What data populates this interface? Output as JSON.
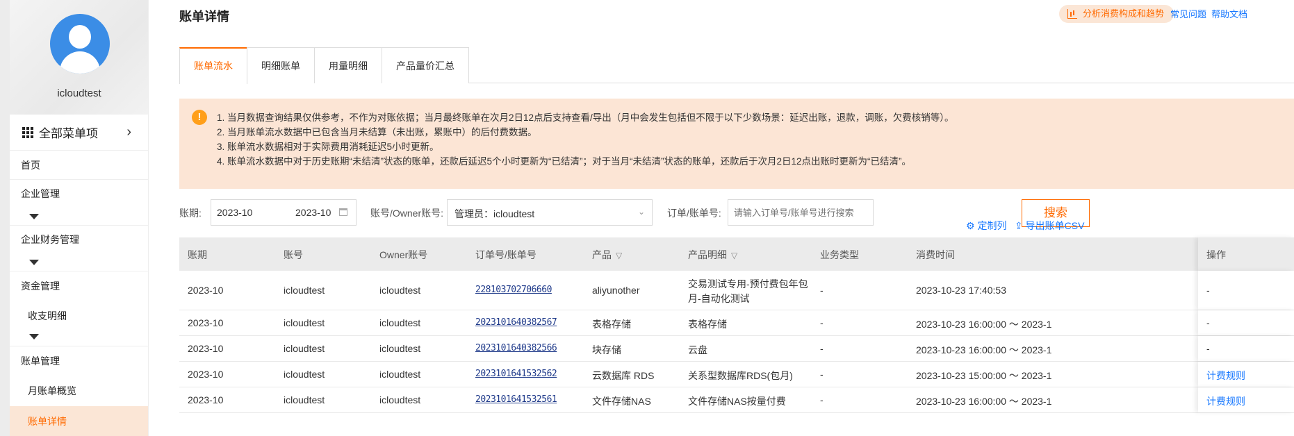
{
  "sidebar": {
    "username": "icloudtest",
    "all_menu": "全部菜单项",
    "items": [
      {
        "label": "首页"
      },
      {
        "label": "企业管理"
      },
      {
        "label": "企业财务管理"
      },
      {
        "label": "资金管理"
      },
      {
        "label": "收支明细"
      },
      {
        "label": "账单管理"
      },
      {
        "label": "月账单概览"
      },
      {
        "label": "账单详情"
      }
    ]
  },
  "header": {
    "title": "账单详情",
    "analyze": "分析消费构成和趋势",
    "faq": "常见问题",
    "help": "帮助文档"
  },
  "tabs": [
    "账单流水",
    "明细账单",
    "用量明细",
    "产品量价汇总"
  ],
  "notice": [
    "1. 当月数据查询结果仅供参考，不作为对账依据；当月最终账单在次月2日12点后支持查看/导出（月中会发生包括但不限于以下少数场景：延迟出账，退款，调账，欠费核销等）。",
    "2. 当月账单流水数据中已包含当月未结算（未出账，累账中）的后付费数据。",
    "3. 账单流水数据相对于实际费用消耗延迟5小时更新。",
    "4. 账单流水数据中对于历史账期“未结清”状态的账单，还款后延迟5个小时更新为“已结清”；对于当月“未结清”状态的账单，还款后于次月2日12点出账时更新为“已结清”。"
  ],
  "filters": {
    "period_label": "账期:",
    "period_start": "2023-10",
    "period_end": "2023-10",
    "account_label": "账号/Owner账号:",
    "account_value": "管理员：icloudtest",
    "order_label": "订单/账单号:",
    "order_placeholder": "请输入订单号/账单号进行搜索",
    "search": "搜索",
    "customize": "定制列",
    "export": "导出账单CSV"
  },
  "table": {
    "headers": [
      "账期",
      "账号",
      "Owner账号",
      "订单号/账单号",
      "产品",
      "产品明细",
      "业务类型",
      "消费时间",
      "操作"
    ],
    "rows": [
      {
        "period": "2023-10",
        "account": "icloudtest",
        "owner": "icloudtest",
        "order": "228103702706660",
        "product": "aliyunother",
        "detail": "交易测试专用-预付费包年包",
        "detail2": "月-自动化测试",
        "biz": "-",
        "time": "2023-10-23 17:40:53",
        "op": "-"
      },
      {
        "period": "2023-10",
        "account": "icloudtest",
        "owner": "icloudtest",
        "order": "2023101640382567",
        "product": "表格存储",
        "detail": "表格存储",
        "detail2": "",
        "biz": "-",
        "time": "2023-10-23 16:00:00 ～ 2023-1",
        "op": "-"
      },
      {
        "period": "2023-10",
        "account": "icloudtest",
        "owner": "icloudtest",
        "order": "2023101640382566",
        "product": "块存储",
        "detail": "云盘",
        "detail2": "",
        "biz": "-",
        "time": "2023-10-23 16:00:00 ～ 2023-1",
        "op": "-"
      },
      {
        "period": "2023-10",
        "account": "icloudtest",
        "owner": "icloudtest",
        "order": "2023101641532562",
        "product": "云数据库 RDS",
        "detail": "关系型数据库RDS(包月)",
        "detail2": "",
        "biz": "-",
        "time": "2023-10-23 15:00:00 ～ 2023-1",
        "op": "计费规则"
      },
      {
        "period": "2023-10",
        "account": "icloudtest",
        "owner": "icloudtest",
        "order": "2023101641532561",
        "product": "文件存储NAS",
        "detail": "文件存储NAS按量付费",
        "detail2": "",
        "biz": "-",
        "time": "2023-10-23 16:00:00 ～ 2023-1",
        "op": "计费规则"
      }
    ]
  }
}
